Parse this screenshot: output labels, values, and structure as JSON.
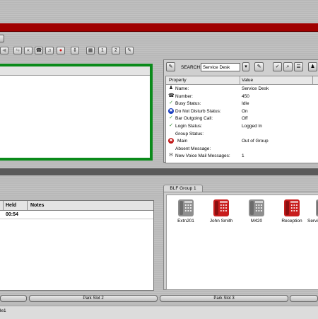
{
  "colors": {
    "red_bar": "#a00000",
    "active_border": "#0a8a1a",
    "divider": "#5a5a5a"
  },
  "toolbar": {
    "buttons": [
      {
        "name": "left-arrow-icon",
        "glyph": "◀"
      },
      {
        "name": "transfer-icon",
        "glyph": "⇆"
      },
      {
        "name": "conference-icon",
        "glyph": "«"
      },
      {
        "name": "handset-icon",
        "glyph": "☎"
      },
      {
        "name": "volume-icon",
        "glyph": "♫"
      },
      {
        "name": "record-icon",
        "glyph": "●"
      },
      {
        "name": "up-down-icon",
        "glyph": "⇕"
      },
      {
        "name": "keypad-icon",
        "glyph": "▦"
      },
      {
        "name": "park-one-icon",
        "glyph": "1"
      },
      {
        "name": "park-two-icon",
        "glyph": "2"
      },
      {
        "name": "settings-wrench-icon",
        "glyph": "✎"
      }
    ]
  },
  "search": {
    "label": "SEARCH:",
    "value": "Service Desk",
    "buttons": [
      "▾",
      "✎",
      "✓",
      "⌕",
      "☰",
      "♟",
      "♟♟",
      "▤"
    ]
  },
  "properties": {
    "headers": {
      "property": "Property",
      "value": "Value"
    },
    "rows": [
      {
        "icon": "person-icon",
        "glyph": "♟",
        "color": "#222",
        "name": "Name:",
        "value": "Service Desk"
      },
      {
        "icon": "phone-icon",
        "glyph": "☎",
        "color": "#222",
        "name": "Number:",
        "value": "450"
      },
      {
        "icon": "check-icon",
        "glyph": "✓",
        "color": "#2a8a2a",
        "name": "Busy Status:",
        "value": "Idle"
      },
      {
        "icon": "dnd-icon",
        "glyph": "✖",
        "color": "#1a3fbf",
        "name": "Do Not Disturb Status:",
        "value": "On"
      },
      {
        "icon": "check-icon",
        "glyph": "✓",
        "color": "#2a8a2a",
        "name": "Bar Outgoing Call:",
        "value": "Off"
      },
      {
        "icon": "check-icon",
        "glyph": "✓",
        "color": "#2a8a2a",
        "name": "Login Status:",
        "value": "Logged In"
      },
      {
        "icon": "",
        "glyph": "",
        "color": "#222",
        "name": "Group Status:",
        "value": ""
      },
      {
        "icon": "error-icon",
        "glyph": "✖",
        "color": "#c01818",
        "name": "  Main",
        "value": "Out of Group"
      },
      {
        "icon": "",
        "glyph": "",
        "color": "#222",
        "name": "Absent Message:",
        "value": ""
      },
      {
        "icon": "voicemail-icon",
        "glyph": "✉",
        "color": "#555",
        "name": "New Voice Mail Messages:",
        "value": "1"
      }
    ]
  },
  "calls": {
    "columns": {
      "held": "Held",
      "notes": "Notes"
    },
    "rows": [
      {
        "held": "00:54",
        "notes": ""
      }
    ]
  },
  "blf": {
    "tab": "BLF Group 1",
    "items": [
      {
        "label": "Extn201",
        "color": "#8f8f8f"
      },
      {
        "label": "John Smith",
        "color": "#c81d1d"
      },
      {
        "label": "M420",
        "color": "#8f8f8f"
      },
      {
        "label": "Reception",
        "color": "#c81d1d"
      },
      {
        "label": "Servi",
        "color": "#8f8f8f"
      }
    ]
  },
  "park": {
    "slots": [
      "",
      "Park Slot 2",
      "Park Slot 3",
      ""
    ]
  },
  "status": {
    "text": "le1"
  }
}
